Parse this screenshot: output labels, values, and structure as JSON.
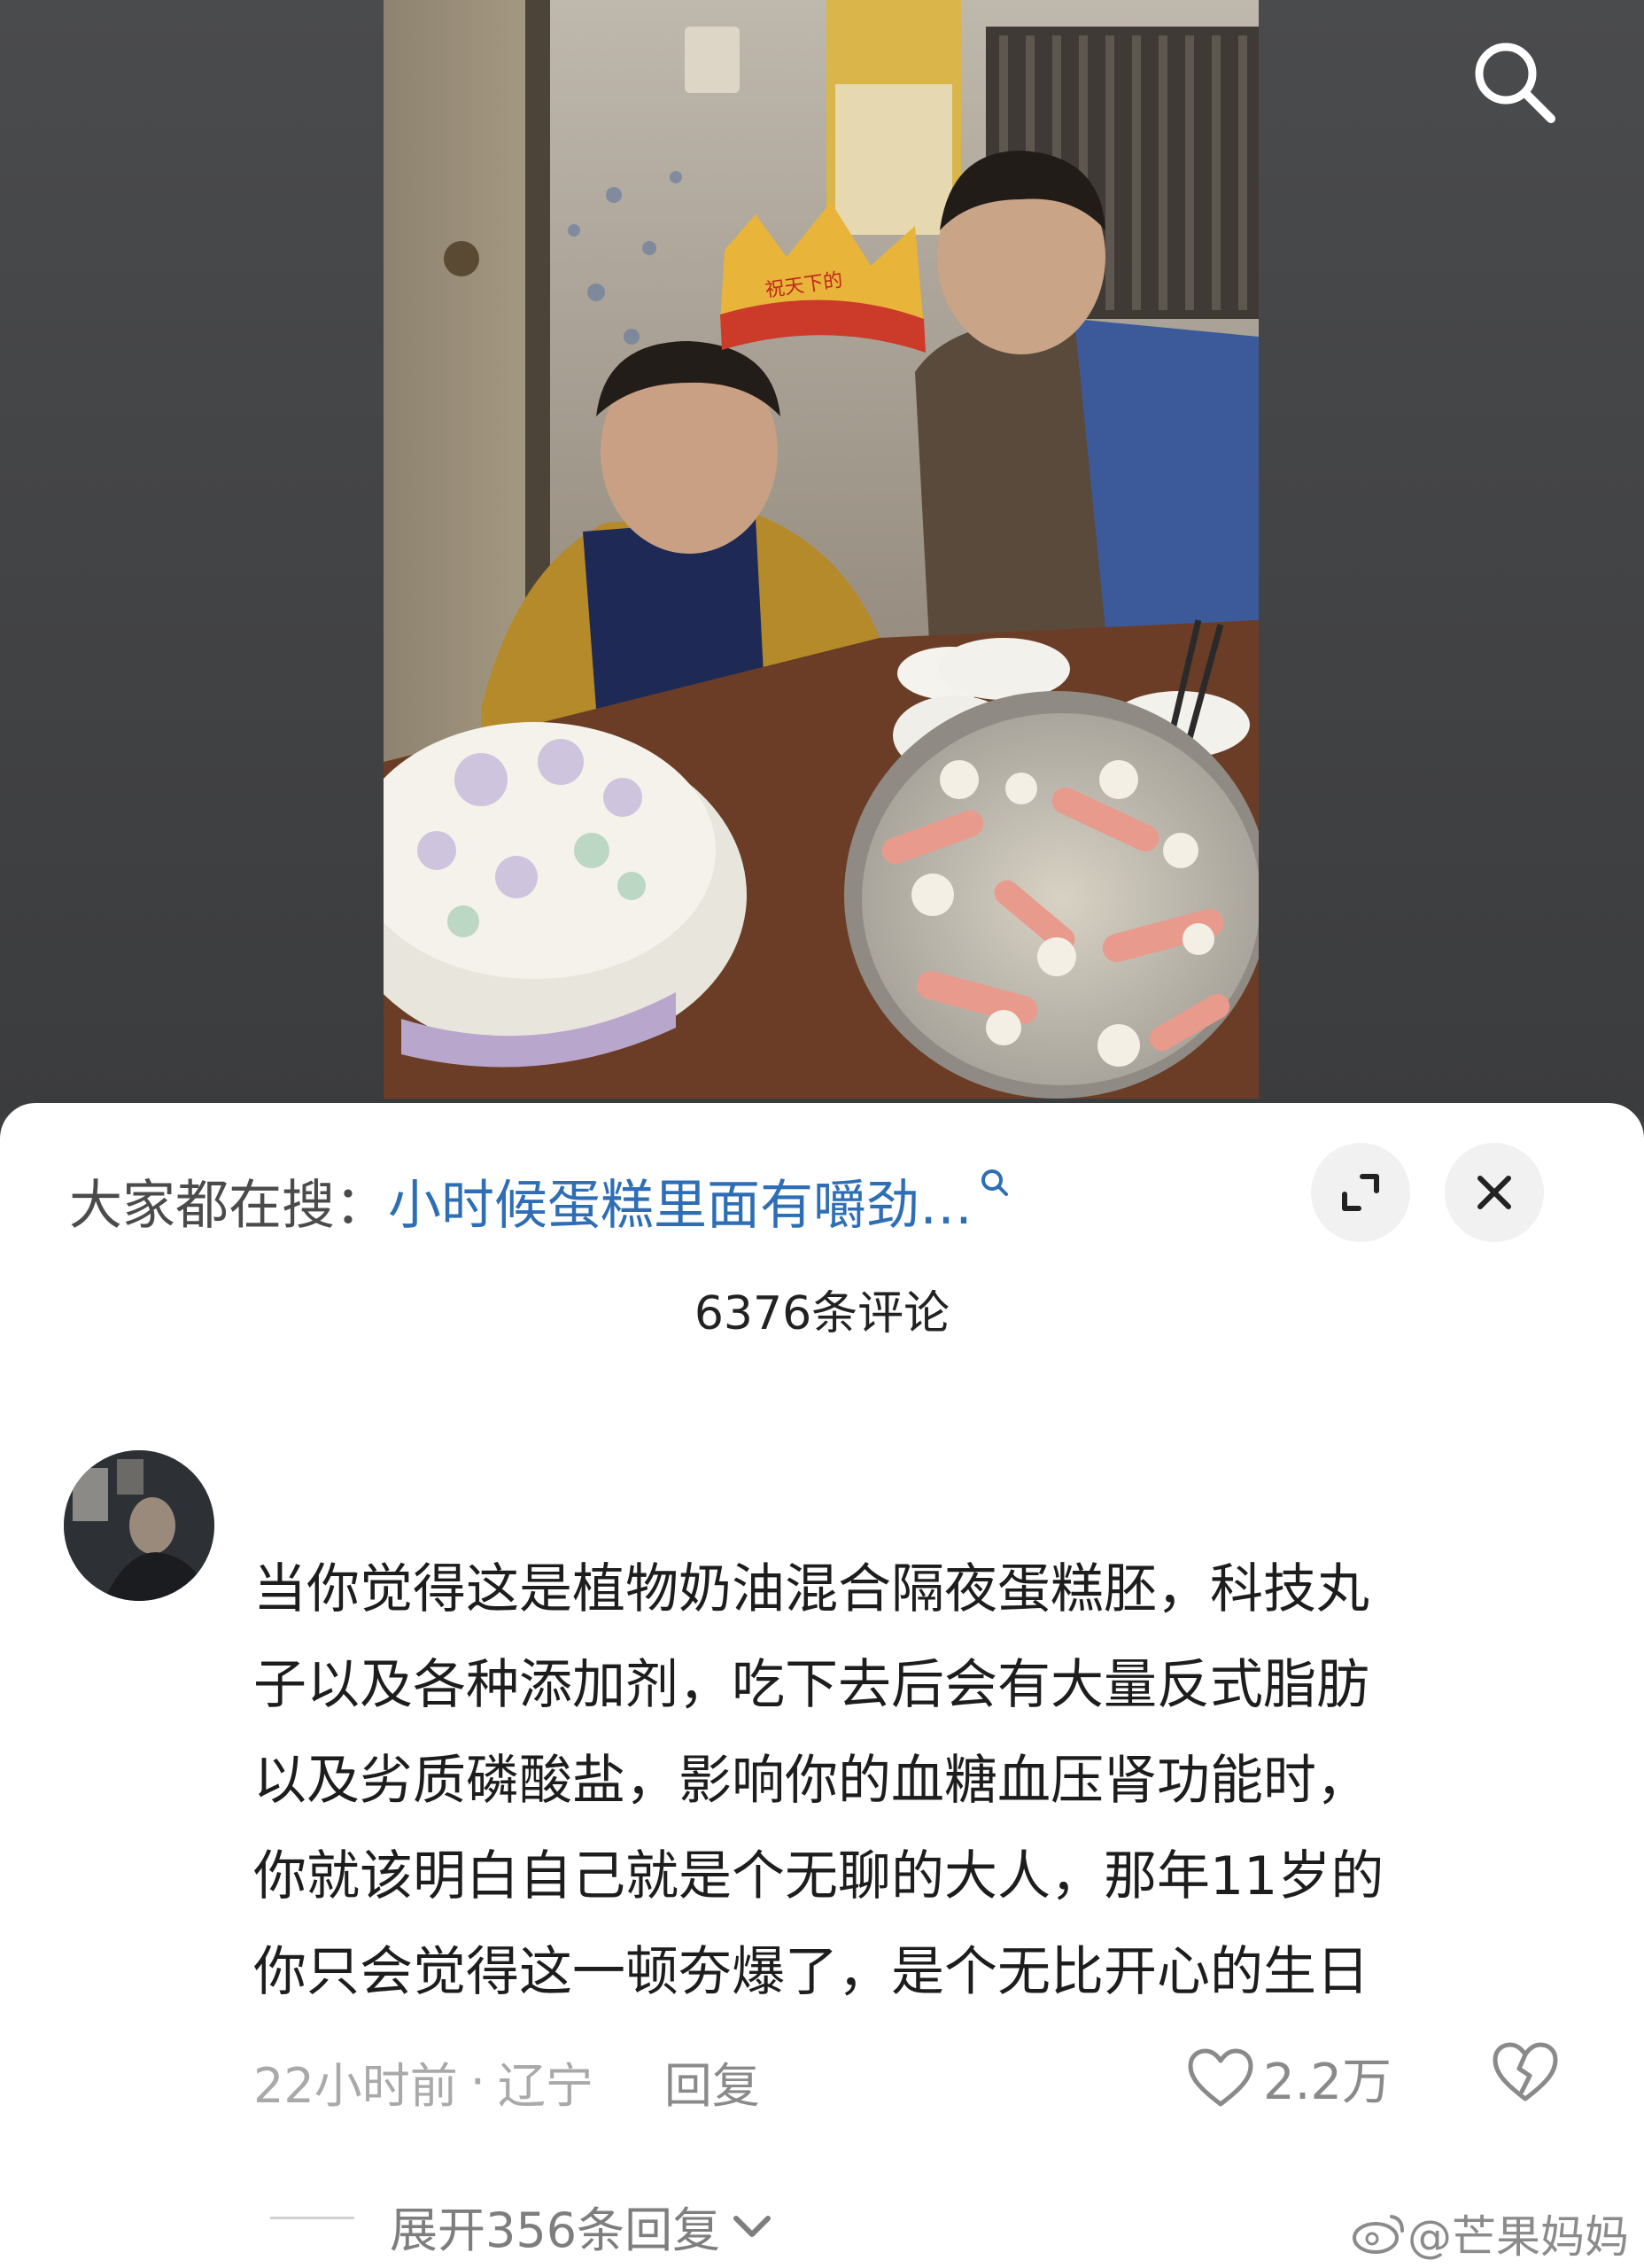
{
  "photo": {
    "crown_text": "祝天下的"
  },
  "header": {
    "search_icon": "search-icon"
  },
  "panel": {
    "suggest_label": "大家都在搜：",
    "suggest_query": "小时候蛋糕里面有嚼劲…",
    "comment_count": "6376条评论",
    "expand_icon": "expand-icon",
    "close_icon": "close-icon"
  },
  "comment": {
    "text_lines": [
      "当你觉得这是植物奶油混合隔夜蛋糕胚，科技丸",
      "子以及各种添加剂，吃下去后会有大量反式脂肪",
      "以及劣质磷酸盐，影响你的血糖血压肾功能时，",
      "你就该明白自己就是个无聊的大人，那年11岁的",
      "你只会觉得这一顿夯爆了，是个无比开心的生日"
    ],
    "time": "22小时前",
    "separator": "·",
    "location": "辽宁",
    "reply_label": "回复",
    "like_count": "2.2万",
    "expand_replies": "展开356条回复"
  },
  "watermark": {
    "text": "@芒果妈妈"
  },
  "colors": {
    "link": "#2e6eb5",
    "text": "#1d1d1d",
    "muted": "#a9a9a9"
  }
}
